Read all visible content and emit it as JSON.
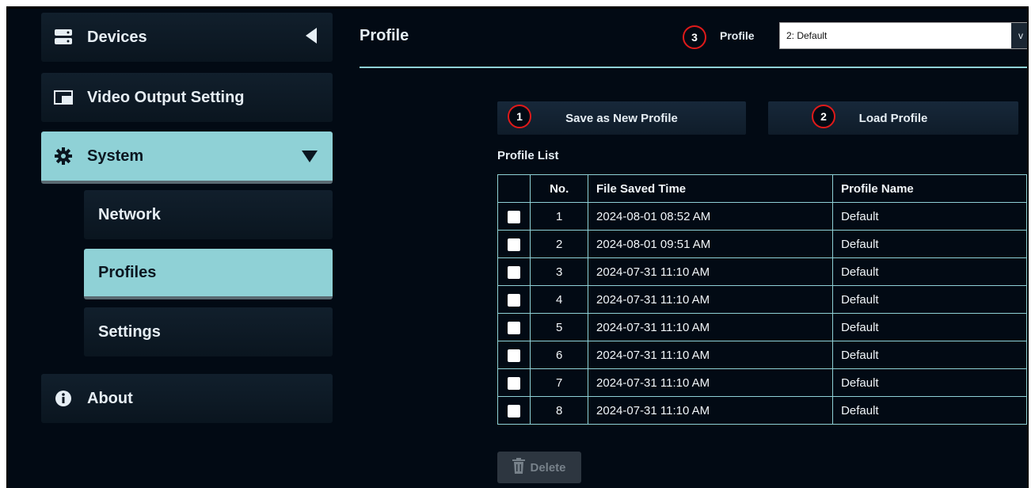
{
  "sidebar": {
    "devices": {
      "label": "Devices",
      "icon": "devices-icon",
      "toggle_icon": "collapse-left-arrow-icon"
    },
    "video_output": {
      "label": "Video Output Setting",
      "icon": "video-output-icon"
    },
    "system": {
      "label": "System",
      "icon": "gear-icon",
      "toggle_icon": "expand-down-arrow-icon"
    },
    "sub_items": [
      {
        "label": "Network"
      },
      {
        "label": "Profiles"
      },
      {
        "label": "Settings"
      }
    ],
    "about": {
      "label": "About",
      "icon": "info-icon"
    }
  },
  "main": {
    "title": "Profile",
    "profile_selector": {
      "badge": "3",
      "label": "Profile",
      "value": "2: Default",
      "caret": "v"
    },
    "save_button": {
      "badge": "1",
      "label": "Save as New Profile"
    },
    "load_button": {
      "badge": "2",
      "label": "Load Profile"
    },
    "list_label": "Profile List",
    "table": {
      "headers": [
        "",
        "No.",
        "File Saved Time",
        "Profile Name"
      ],
      "rows": [
        {
          "no": "1",
          "time": "2024-08-01 08:52 AM",
          "name": "Default"
        },
        {
          "no": "2",
          "time": "2024-08-01 09:51 AM",
          "name": "Default"
        },
        {
          "no": "3",
          "time": "2024-07-31 11:10 AM",
          "name": "Default"
        },
        {
          "no": "4",
          "time": "2024-07-31 11:10 AM",
          "name": "Default"
        },
        {
          "no": "5",
          "time": "2024-07-31 11:10 AM",
          "name": "Default"
        },
        {
          "no": "6",
          "time": "2024-07-31 11:10 AM",
          "name": "Default"
        },
        {
          "no": "7",
          "time": "2024-07-31 11:10 AM",
          "name": "Default"
        },
        {
          "no": "8",
          "time": "2024-07-31 11:10 AM",
          "name": "Default"
        }
      ]
    },
    "delete_button": {
      "label": "Delete",
      "icon": "trash-icon"
    }
  },
  "colors": {
    "accent": "#8fd1d6",
    "background": "#020a14",
    "badge_ring": "#e01a1a"
  }
}
